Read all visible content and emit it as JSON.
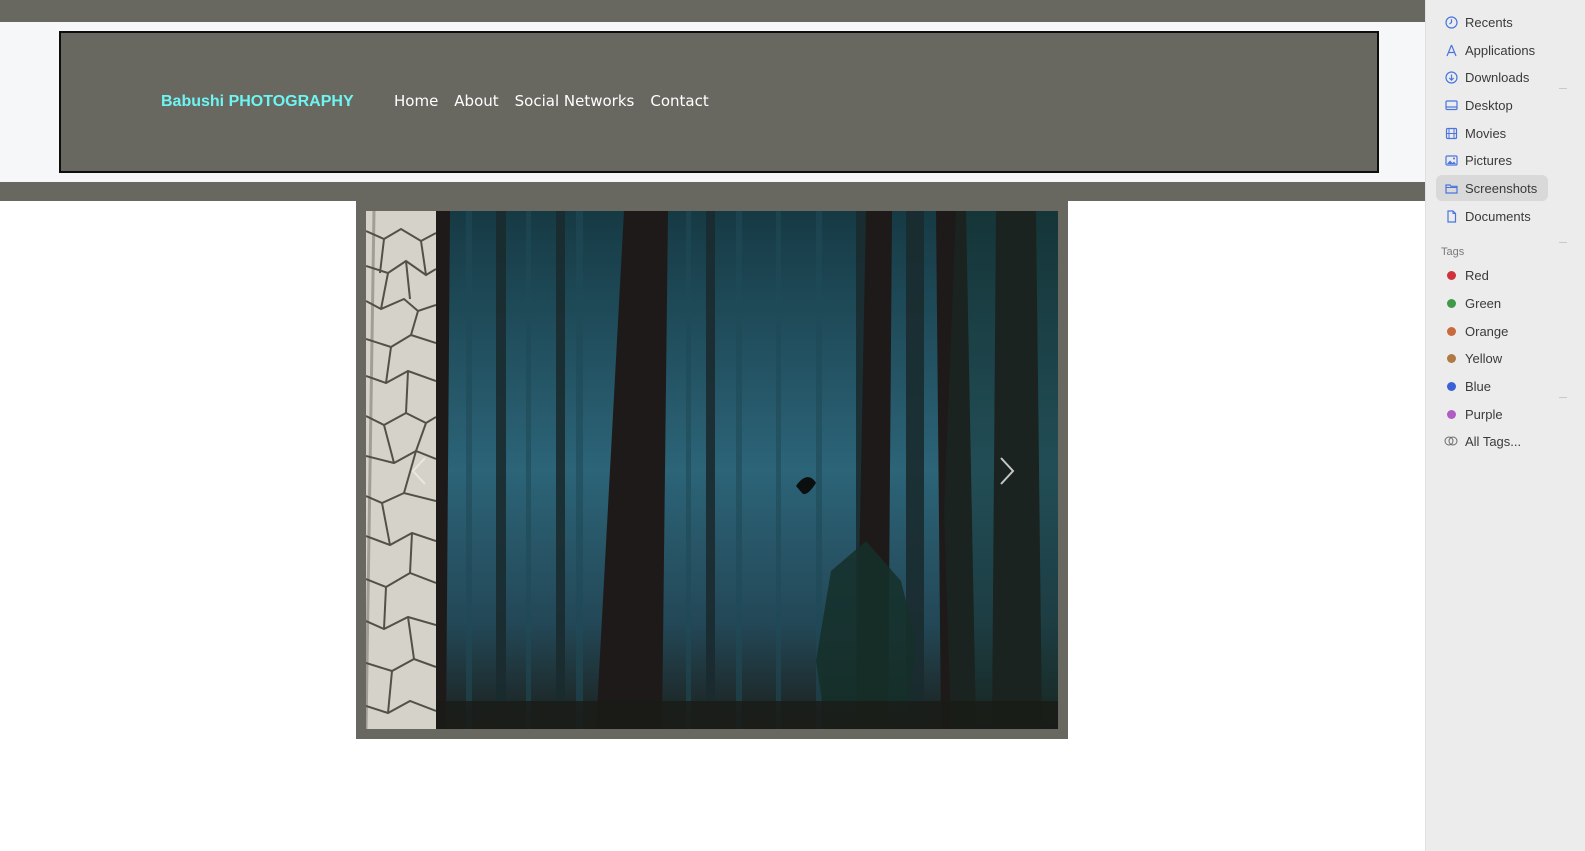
{
  "site": {
    "brand": "Babushi PHOTOGRAPHY",
    "nav": [
      "Home",
      "About",
      "Social Networks",
      "Contact"
    ]
  },
  "carousel": {
    "prev_icon": "chevron-left-icon",
    "next_icon": "chevron-right-icon"
  },
  "finder": {
    "favorites": [
      {
        "label": "Recents",
        "icon": "clock-icon"
      },
      {
        "label": "Applications",
        "icon": "applications-icon"
      },
      {
        "label": "Downloads",
        "icon": "download-icon"
      },
      {
        "label": "Desktop",
        "icon": "desktop-icon"
      },
      {
        "label": "Movies",
        "icon": "film-icon"
      },
      {
        "label": "Pictures",
        "icon": "photo-icon"
      },
      {
        "label": "Screenshots",
        "icon": "folder-icon",
        "selected": true
      },
      {
        "label": "Documents",
        "icon": "document-icon"
      }
    ],
    "tags_title": "Tags",
    "tags": [
      {
        "label": "Red",
        "color": "#d0323c"
      },
      {
        "label": "Green",
        "color": "#3e9a48"
      },
      {
        "label": "Orange",
        "color": "#c86a3c"
      },
      {
        "label": "Yellow",
        "color": "#b07a43"
      },
      {
        "label": "Blue",
        "color": "#3a62d8"
      },
      {
        "label": "Purple",
        "color": "#b05cc4"
      }
    ],
    "all_tags": "All Tags..."
  },
  "colors": {
    "nav_bg": "#686861",
    "brand": "#6ef5f1",
    "finder_icon": "#4a74e0"
  }
}
